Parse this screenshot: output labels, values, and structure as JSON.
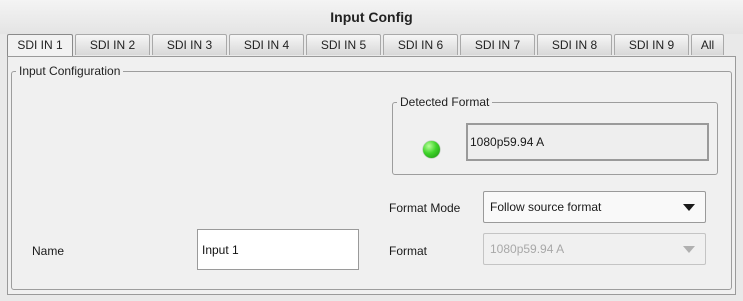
{
  "window": {
    "title": "Input Config"
  },
  "tabs": [
    {
      "label": "SDI IN 1",
      "active": true
    },
    {
      "label": "SDI IN 2",
      "active": false
    },
    {
      "label": "SDI IN 3",
      "active": false
    },
    {
      "label": "SDI IN 4",
      "active": false
    },
    {
      "label": "SDI IN 5",
      "active": false
    },
    {
      "label": "SDI IN 6",
      "active": false
    },
    {
      "label": "SDI IN 7",
      "active": false
    },
    {
      "label": "SDI IN 8",
      "active": false
    },
    {
      "label": "SDI IN 9",
      "active": false
    },
    {
      "label": "All",
      "active": false
    }
  ],
  "input_configuration": {
    "group_label": "Input Configuration",
    "detected_format": {
      "group_label": "Detected Format",
      "value": "1080p59.94 A",
      "status_color": "#2ecc1f",
      "status_icon": "led-icon"
    },
    "format_mode": {
      "label": "Format Mode",
      "selected": "Follow source format"
    },
    "format": {
      "label": "Format",
      "selected": "1080p59.94 A",
      "disabled": true
    },
    "name": {
      "label": "Name",
      "value": "Input 1"
    }
  }
}
